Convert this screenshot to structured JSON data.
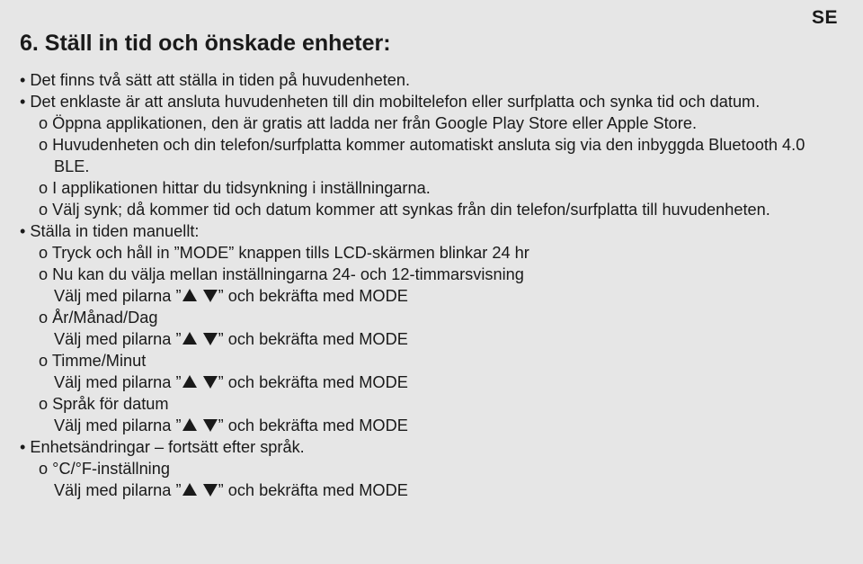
{
  "langTag": "SE",
  "heading": "6. Ställ in tid och önskade enheter:",
  "lines": {
    "a1": "Det finns två sätt att ställa in tiden på huvudenheten.",
    "a2": "Det enklaste är att ansluta huvudenheten till din mobiltelefon eller surfplatta och synka tid och datum.",
    "a3": "Öppna applikationen, den är gratis att ladda ner från Google Play Store eller Apple Store.",
    "a4": "Huvudenheten och din telefon/surfplatta kommer automatiskt ansluta sig via den inbyggda Bluetooth 4.0 BLE.",
    "a5": "I applikationen hittar du tidsynkning i inställningarna.",
    "a6": "Välj synk; då kommer tid och datum kommer att synkas från din telefon/surfplatta till huvudenheten.",
    "a7": "Ställa in tiden manuellt:",
    "a8": "Tryck och håll in ”MODE” knappen tills LCD-skärmen blinkar 24 hr",
    "a9": "Nu kan du välja mellan inställningarna 24- och 12-timmarsvisning",
    "arrowPre": "Välj med pilarna ”",
    "arrowPost": "” och bekräfta med MODE",
    "b1": "År/Månad/Dag",
    "b2": "Timme/Minut",
    "b3": "Språk för datum",
    "c1": "Enhetsändringar – fortsätt efter språk.",
    "c2": "°C/°F-inställning"
  }
}
